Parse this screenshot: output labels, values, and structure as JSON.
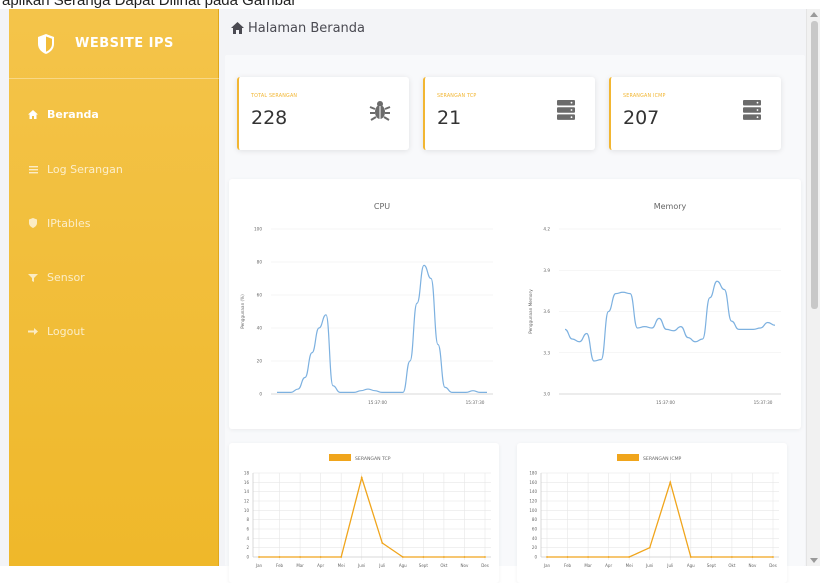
{
  "caption": "apilkan Seranga Dapat Dilihat pada Gambar",
  "sidebar": {
    "brand": "WEBSITE IPS",
    "items": [
      {
        "label": "Beranda",
        "icon": "home-icon",
        "active": true
      },
      {
        "label": "Log Serangan",
        "icon": "list-icon",
        "active": false
      },
      {
        "label": "IPtables",
        "icon": "shield-icon",
        "active": false
      },
      {
        "label": "Sensor",
        "icon": "sensor-icon",
        "active": false
      },
      {
        "label": "Logout",
        "icon": "logout-icon",
        "active": false
      }
    ]
  },
  "header": {
    "title": "Halaman Beranda",
    "icon": "home-icon"
  },
  "stats": [
    {
      "label": "TOTAL SERANGAN",
      "value": "228",
      "icon": "bug-icon"
    },
    {
      "label": "SERANGAN TCP",
      "value": "21",
      "icon": "server-icon"
    },
    {
      "label": "SERANGAN ICMP",
      "value": "207",
      "icon": "server-icon"
    }
  ],
  "colors": {
    "accent": "#f2b632",
    "sidebar": "#f2bd3a",
    "line_blue": "#7db1e0",
    "line_orange": "#f0a51c"
  },
  "chart_data": [
    {
      "type": "line",
      "title": "CPU",
      "ylabel": "Penggunaan (%)",
      "xlabel": "",
      "ylim": [
        0,
        100
      ],
      "yticks": [
        0,
        20,
        40,
        60,
        80,
        100
      ],
      "xtick_labels": [
        "15:37:00",
        "15:37:30"
      ],
      "series": [
        {
          "values": [
            1,
            1,
            1,
            3,
            10,
            25,
            40,
            48,
            5,
            1,
            1,
            1,
            2,
            3,
            2,
            1,
            1,
            1,
            1,
            20,
            55,
            78,
            70,
            30,
            4,
            1,
            1,
            1,
            2,
            1,
            1
          ]
        }
      ]
    },
    {
      "type": "line",
      "title": "Memory",
      "ylabel": "Penggunaan Memory",
      "xlabel": "",
      "ylim": [
        3.0,
        4.2
      ],
      "yticks": [
        "3.0",
        "3.3",
        "3.6",
        "3.9",
        "4.2"
      ],
      "xtick_labels": [
        "15:37:00",
        "15:37:30"
      ],
      "series": [
        {
          "values": [
            3.47,
            3.4,
            3.38,
            3.44,
            3.24,
            3.25,
            3.6,
            3.73,
            3.74,
            3.73,
            3.48,
            3.49,
            3.48,
            3.55,
            3.47,
            3.46,
            3.49,
            3.41,
            3.38,
            3.4,
            3.7,
            3.82,
            3.76,
            3.53,
            3.47,
            3.47,
            3.47,
            3.48,
            3.52,
            3.5
          ]
        }
      ]
    },
    {
      "type": "line",
      "title": "",
      "xlabel": "",
      "ylabel": "",
      "ylim": [
        0,
        18
      ],
      "yticks": [
        0,
        2,
        4,
        6,
        8,
        10,
        12,
        14,
        16,
        18
      ],
      "categories": [
        "Jan",
        "Feb",
        "Mar",
        "Apr",
        "Mei",
        "Juni",
        "Juli",
        "Agu",
        "Sept",
        "Okt",
        "Nov",
        "Des"
      ],
      "series": [
        {
          "name": "SERANGAN TCP",
          "values": [
            0,
            0,
            0,
            0,
            0,
            17,
            3,
            0,
            0,
            0,
            0,
            0
          ]
        }
      ]
    },
    {
      "type": "line",
      "title": "",
      "xlabel": "",
      "ylabel": "",
      "ylim": [
        0,
        180
      ],
      "yticks": [
        0,
        20,
        40,
        60,
        80,
        100,
        120,
        140,
        160,
        180
      ],
      "categories": [
        "Jan",
        "Feb",
        "Mar",
        "Apr",
        "Mei",
        "Juni",
        "Juli",
        "Agu",
        "Sept",
        "Okt",
        "Nov",
        "Des"
      ],
      "series": [
        {
          "name": "SERANGAN ICMP",
          "values": [
            0,
            0,
            0,
            0,
            0,
            20,
            160,
            0,
            0,
            0,
            0,
            0
          ]
        }
      ]
    }
  ]
}
